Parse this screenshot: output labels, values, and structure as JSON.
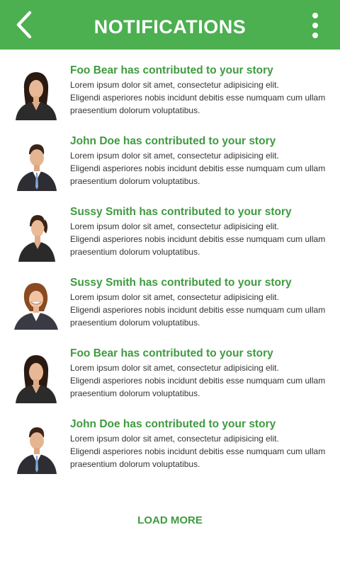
{
  "header": {
    "title": "NOTIFICATIONS",
    "back_icon": "chevron-left-icon",
    "menu_icon": "more-vertical-icon",
    "color": "#4caf50"
  },
  "notifications": [
    {
      "title": "Foo Bear has contributed to your story",
      "line1": "Lorem ipsum dolor sit amet, consectetur adipisicing elit.",
      "line2": "Eligendi asperiores nobis incidunt debitis esse numquam cum ullam",
      "line3": "praesentium dolorum voluptatibus.",
      "avatar": "female-dark-hair"
    },
    {
      "title": "John Doe has contributed to your story",
      "line1": "Lorem ipsum dolor sit amet, consectetur adipisicing elit.",
      "line2": "Eligendi asperiores nobis incidunt debitis esse numquam cum ullam",
      "line3": "praesentium dolorum voluptatibus.",
      "avatar": "male-suit"
    },
    {
      "title": "Sussy Smith has contributed to your story",
      "line1": "Lorem ipsum dolor sit amet, consectetur adipisicing elit.",
      "line2": "Eligendi asperiores nobis incidunt debitis esse numquam cum ullam",
      "line3": "praesentium dolorum voluptatibus.",
      "avatar": "female-ponytail"
    },
    {
      "title": "Sussy Smith has contributed to your story",
      "line1": "Lorem ipsum dolor sit amet, consectetur adipisicing elit.",
      "line2": "Eligendi asperiores nobis incidunt debitis esse numquam cum ullam",
      "line3": "praesentium dolorum voluptatibus.",
      "avatar": "female-smiling"
    },
    {
      "title": "Foo Bear has contributed to your story",
      "line1": "Lorem ipsum dolor sit amet, consectetur adipisicing elit.",
      "line2": "Eligendi asperiores nobis incidunt debitis esse numquam cum ullam",
      "line3": "praesentium dolorum voluptatibus.",
      "avatar": "female-dark-hair"
    },
    {
      "title": "John Doe has contributed to your story",
      "line1": "Lorem ipsum dolor sit amet, consectetur adipisicing elit.",
      "line2": "Eligendi asperiores nobis incidunt debitis esse numquam cum ullam",
      "line3": "praesentium dolorum voluptatibus.",
      "avatar": "male-suit"
    }
  ],
  "load_more_label": "LOAD MORE",
  "accent_color": "#3f9b3f"
}
